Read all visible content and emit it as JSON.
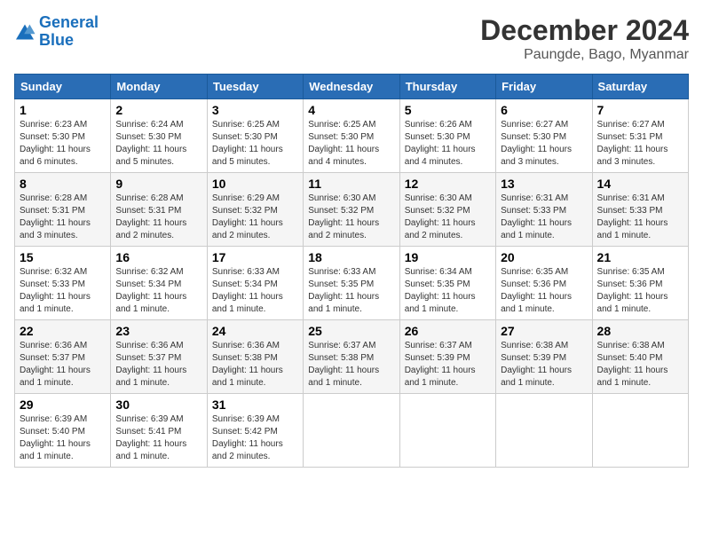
{
  "logo": {
    "general": "General",
    "blue": "Blue"
  },
  "title": "December 2024",
  "subtitle": "Paungde, Bago, Myanmar",
  "days_header": [
    "Sunday",
    "Monday",
    "Tuesday",
    "Wednesday",
    "Thursday",
    "Friday",
    "Saturday"
  ],
  "weeks": [
    [
      {
        "day": "1",
        "info": "Sunrise: 6:23 AM\nSunset: 5:30 PM\nDaylight: 11 hours\nand 6 minutes."
      },
      {
        "day": "2",
        "info": "Sunrise: 6:24 AM\nSunset: 5:30 PM\nDaylight: 11 hours\nand 5 minutes."
      },
      {
        "day": "3",
        "info": "Sunrise: 6:25 AM\nSunset: 5:30 PM\nDaylight: 11 hours\nand 5 minutes."
      },
      {
        "day": "4",
        "info": "Sunrise: 6:25 AM\nSunset: 5:30 PM\nDaylight: 11 hours\nand 4 minutes."
      },
      {
        "day": "5",
        "info": "Sunrise: 6:26 AM\nSunset: 5:30 PM\nDaylight: 11 hours\nand 4 minutes."
      },
      {
        "day": "6",
        "info": "Sunrise: 6:27 AM\nSunset: 5:30 PM\nDaylight: 11 hours\nand 3 minutes."
      },
      {
        "day": "7",
        "info": "Sunrise: 6:27 AM\nSunset: 5:31 PM\nDaylight: 11 hours\nand 3 minutes."
      }
    ],
    [
      {
        "day": "8",
        "info": "Sunrise: 6:28 AM\nSunset: 5:31 PM\nDaylight: 11 hours\nand 3 minutes."
      },
      {
        "day": "9",
        "info": "Sunrise: 6:28 AM\nSunset: 5:31 PM\nDaylight: 11 hours\nand 2 minutes."
      },
      {
        "day": "10",
        "info": "Sunrise: 6:29 AM\nSunset: 5:32 PM\nDaylight: 11 hours\nand 2 minutes."
      },
      {
        "day": "11",
        "info": "Sunrise: 6:30 AM\nSunset: 5:32 PM\nDaylight: 11 hours\nand 2 minutes."
      },
      {
        "day": "12",
        "info": "Sunrise: 6:30 AM\nSunset: 5:32 PM\nDaylight: 11 hours\nand 2 minutes."
      },
      {
        "day": "13",
        "info": "Sunrise: 6:31 AM\nSunset: 5:33 PM\nDaylight: 11 hours\nand 1 minute."
      },
      {
        "day": "14",
        "info": "Sunrise: 6:31 AM\nSunset: 5:33 PM\nDaylight: 11 hours\nand 1 minute."
      }
    ],
    [
      {
        "day": "15",
        "info": "Sunrise: 6:32 AM\nSunset: 5:33 PM\nDaylight: 11 hours\nand 1 minute."
      },
      {
        "day": "16",
        "info": "Sunrise: 6:32 AM\nSunset: 5:34 PM\nDaylight: 11 hours\nand 1 minute."
      },
      {
        "day": "17",
        "info": "Sunrise: 6:33 AM\nSunset: 5:34 PM\nDaylight: 11 hours\nand 1 minute."
      },
      {
        "day": "18",
        "info": "Sunrise: 6:33 AM\nSunset: 5:35 PM\nDaylight: 11 hours\nand 1 minute."
      },
      {
        "day": "19",
        "info": "Sunrise: 6:34 AM\nSunset: 5:35 PM\nDaylight: 11 hours\nand 1 minute."
      },
      {
        "day": "20",
        "info": "Sunrise: 6:35 AM\nSunset: 5:36 PM\nDaylight: 11 hours\nand 1 minute."
      },
      {
        "day": "21",
        "info": "Sunrise: 6:35 AM\nSunset: 5:36 PM\nDaylight: 11 hours\nand 1 minute."
      }
    ],
    [
      {
        "day": "22",
        "info": "Sunrise: 6:36 AM\nSunset: 5:37 PM\nDaylight: 11 hours\nand 1 minute."
      },
      {
        "day": "23",
        "info": "Sunrise: 6:36 AM\nSunset: 5:37 PM\nDaylight: 11 hours\nand 1 minute."
      },
      {
        "day": "24",
        "info": "Sunrise: 6:36 AM\nSunset: 5:38 PM\nDaylight: 11 hours\nand 1 minute."
      },
      {
        "day": "25",
        "info": "Sunrise: 6:37 AM\nSunset: 5:38 PM\nDaylight: 11 hours\nand 1 minute."
      },
      {
        "day": "26",
        "info": "Sunrise: 6:37 AM\nSunset: 5:39 PM\nDaylight: 11 hours\nand 1 minute."
      },
      {
        "day": "27",
        "info": "Sunrise: 6:38 AM\nSunset: 5:39 PM\nDaylight: 11 hours\nand 1 minute."
      },
      {
        "day": "28",
        "info": "Sunrise: 6:38 AM\nSunset: 5:40 PM\nDaylight: 11 hours\nand 1 minute."
      }
    ],
    [
      {
        "day": "29",
        "info": "Sunrise: 6:39 AM\nSunset: 5:40 PM\nDaylight: 11 hours\nand 1 minute."
      },
      {
        "day": "30",
        "info": "Sunrise: 6:39 AM\nSunset: 5:41 PM\nDaylight: 11 hours\nand 1 minute."
      },
      {
        "day": "31",
        "info": "Sunrise: 6:39 AM\nSunset: 5:42 PM\nDaylight: 11 hours\nand 2 minutes."
      },
      null,
      null,
      null,
      null
    ]
  ]
}
